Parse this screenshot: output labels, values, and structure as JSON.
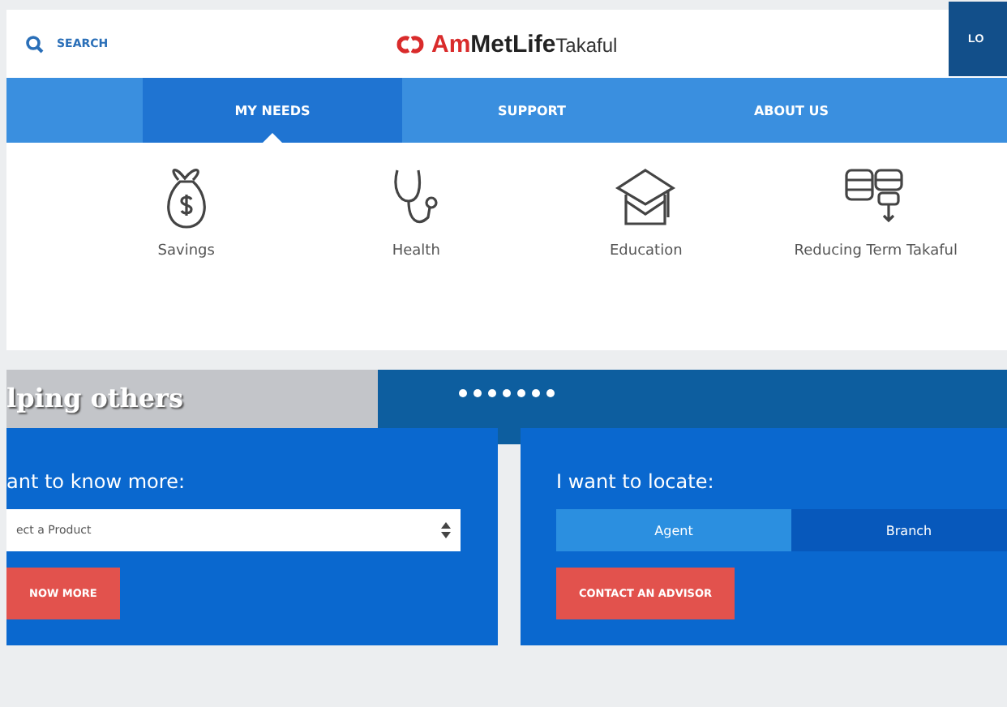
{
  "header": {
    "search_label": "SEARCH",
    "logo": {
      "prefix": "Am",
      "brand": "MetLife",
      "suffix": "Takaful"
    },
    "login_label": "LO"
  },
  "nav": [
    {
      "label": "MY NEEDS",
      "selected": true
    },
    {
      "label": "SUPPORT",
      "selected": false
    },
    {
      "label": "ABOUT US",
      "selected": false
    }
  ],
  "needs": [
    {
      "kind": "savings",
      "label": "Savings"
    },
    {
      "kind": "health",
      "label": "Health"
    },
    {
      "kind": "education",
      "label": "Education"
    },
    {
      "kind": "term",
      "label": "Reducing Term Takaful"
    }
  ],
  "banner": {
    "title": "lping others",
    "dots": [
      {
        "selected": false
      },
      {
        "selected": false
      },
      {
        "selected": false
      },
      {
        "selected": false
      },
      {
        "selected": false
      },
      {
        "selected": false
      },
      {
        "selected": false
      }
    ]
  },
  "know_more": {
    "heading": "ant to know more:",
    "select_value": "ect a Product",
    "button": "NOW MORE"
  },
  "locate": {
    "heading": "I want to locate:",
    "tabs": [
      {
        "label": "Agent",
        "selected": true
      },
      {
        "label": "Branch",
        "selected": false
      }
    ],
    "button": "CONTACT AN ADVISOR"
  }
}
